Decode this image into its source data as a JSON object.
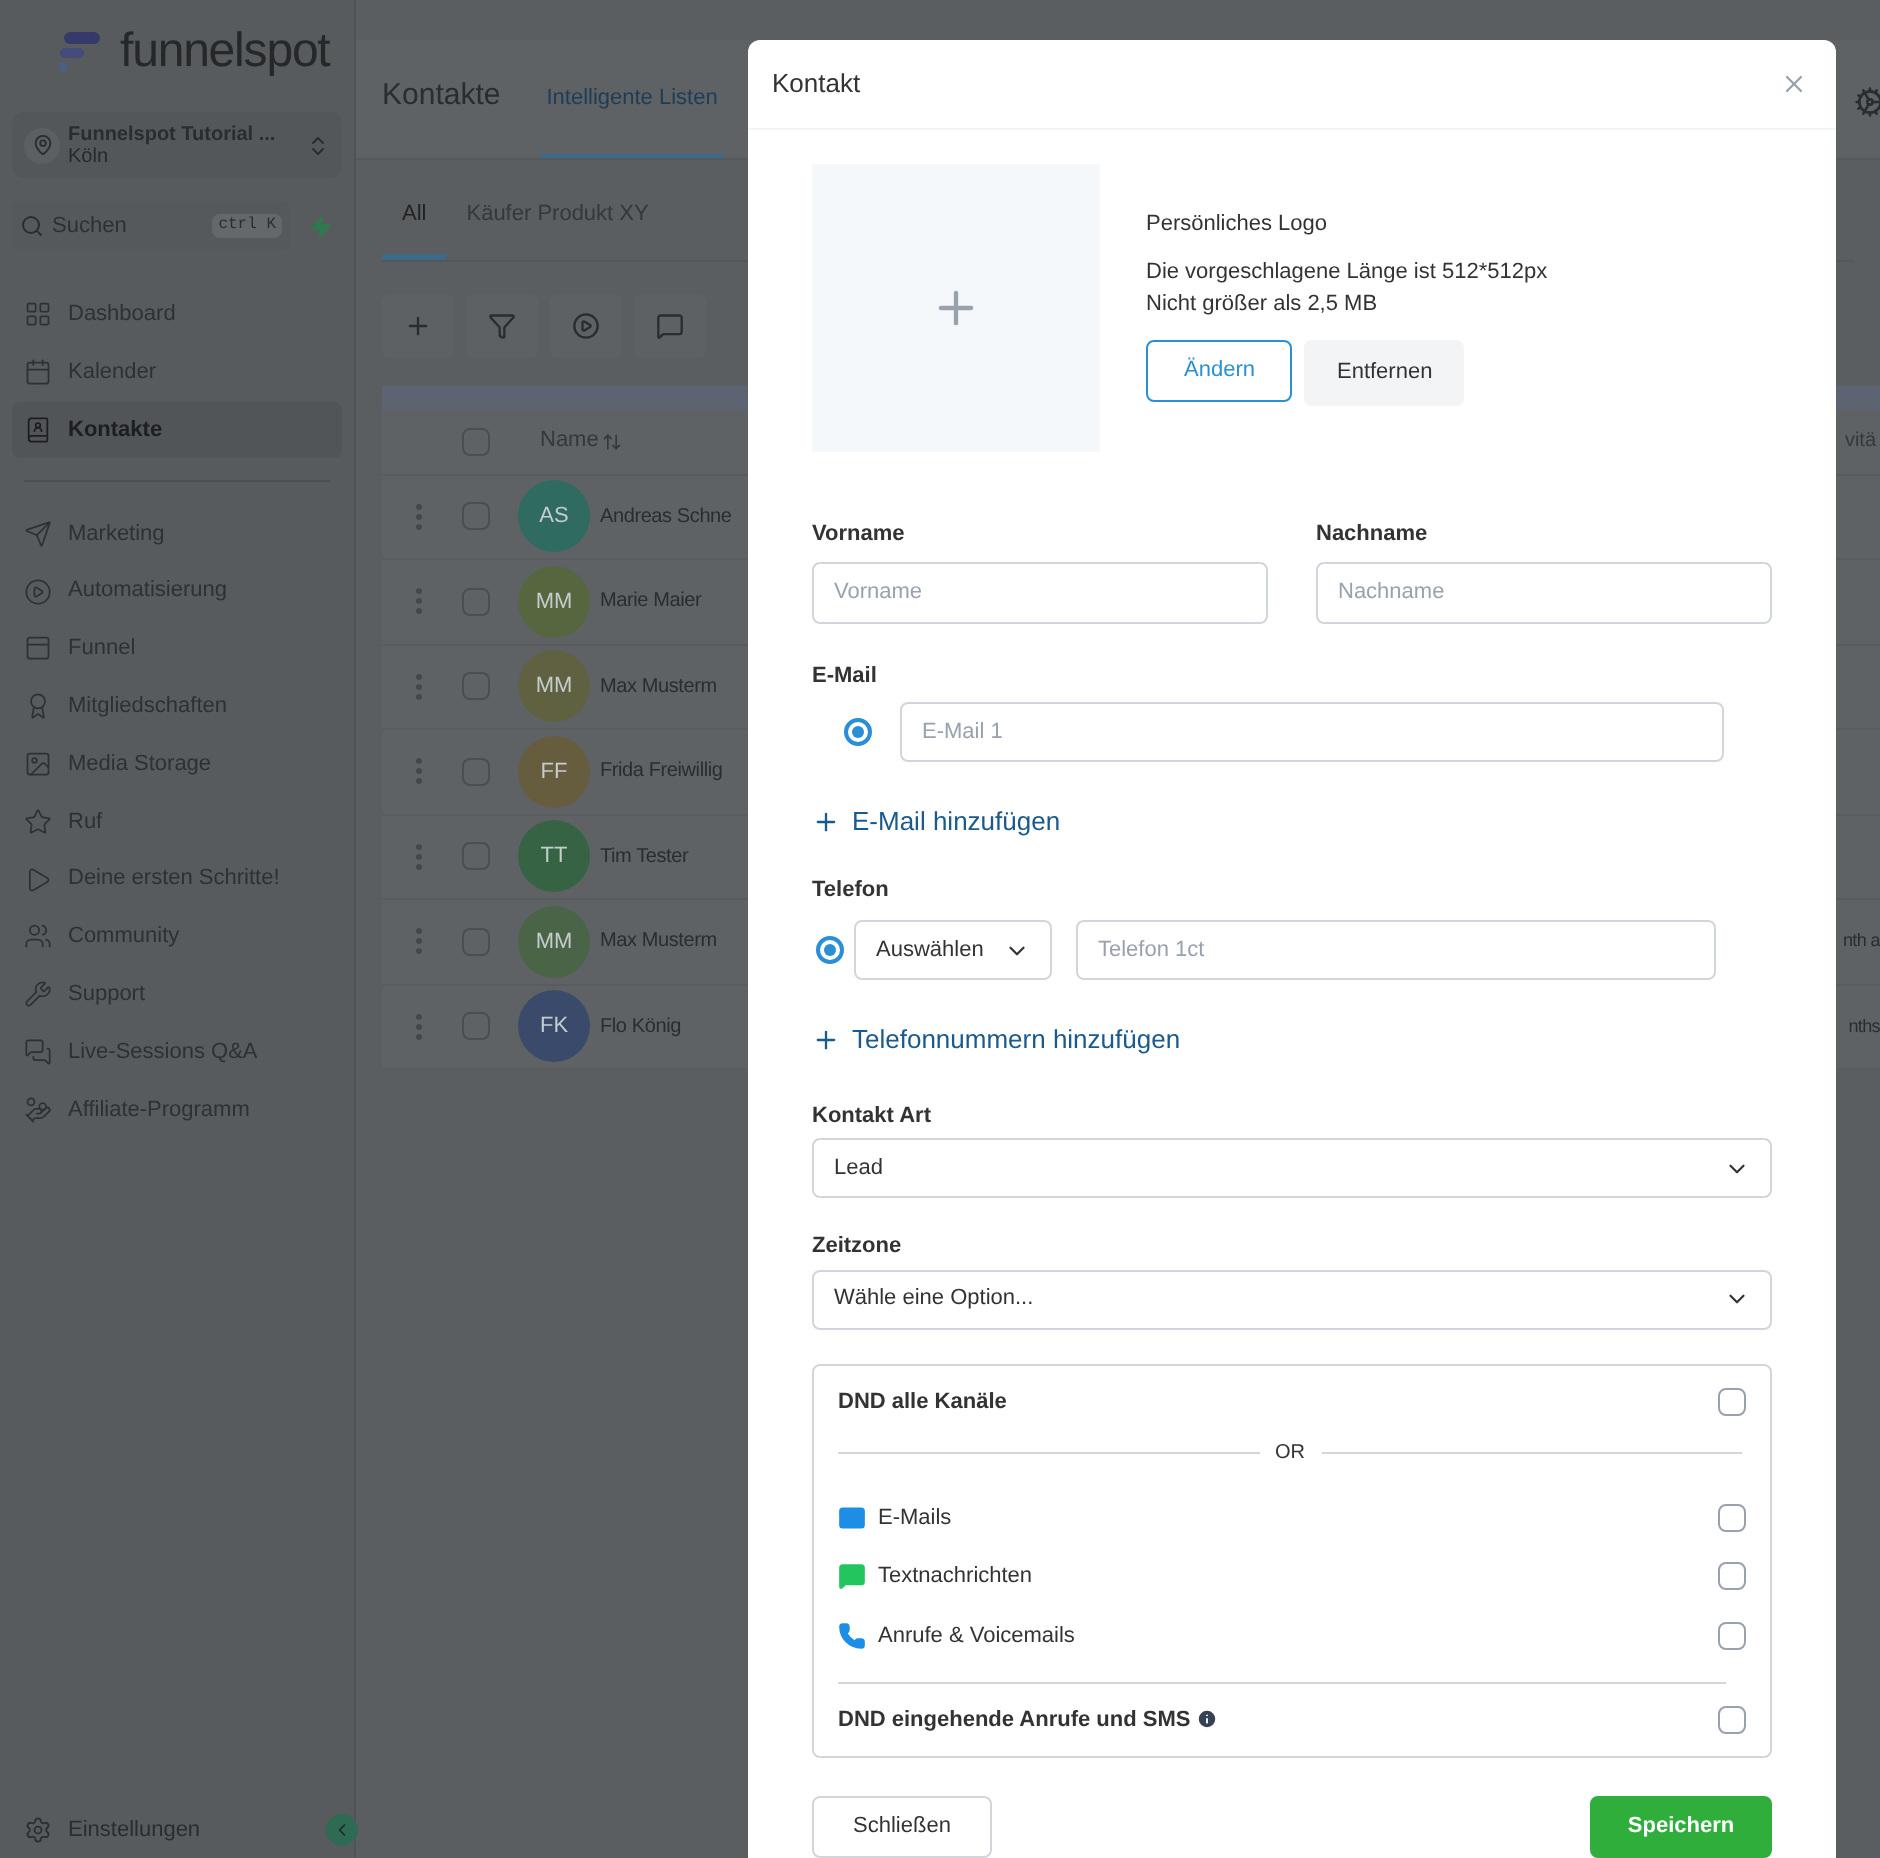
{
  "sidebar": {
    "logo": "funnelspot",
    "account": {
      "name": "Funnelspot Tutorial ...",
      "location": "Köln"
    },
    "search": {
      "placeholder": "Suchen",
      "shortcut": "ctrl K"
    },
    "sections": [
      {
        "items": [
          {
            "label": "Dashboard",
            "selected": false
          },
          {
            "label": "Kalender",
            "selected": false
          },
          {
            "label": "Kontakte",
            "selected": true
          }
        ]
      },
      {
        "items": [
          {
            "label": "Marketing",
            "selected": false
          },
          {
            "label": "Automatisierung",
            "selected": false
          },
          {
            "label": "Funnel",
            "selected": false
          },
          {
            "label": "Mitgliedschaften",
            "selected": false
          },
          {
            "label": "Media Storage",
            "selected": false
          },
          {
            "label": "Ruf",
            "selected": false
          },
          {
            "label": "Deine ersten Schritte!",
            "selected": false
          },
          {
            "label": "Community",
            "selected": false
          },
          {
            "label": "Support",
            "selected": false
          },
          {
            "label": "Live-Sessions Q&A",
            "selected": false
          },
          {
            "label": "Affiliate-Programm",
            "selected": false
          }
        ]
      }
    ],
    "settings": "Einstellungen"
  },
  "header": {
    "title": "Kontakte",
    "tabs": [
      {
        "label": "Intelligente Listen",
        "selected": true
      }
    ]
  },
  "list_tabs": [
    {
      "label": "All",
      "selected": true
    },
    {
      "label": "Käufer Produkt XY",
      "selected": false
    }
  ],
  "table": {
    "columns": [
      "Name",
      "vitä"
    ],
    "all_checked": false,
    "rows": [
      {
        "initials": "AS",
        "name": "Andreas Schne",
        "color": "#2f6b60",
        "checked": false
      },
      {
        "initials": "MM",
        "name": "Marie Maier",
        "color": "#56663f",
        "checked": false
      },
      {
        "initials": "MM",
        "name": "Max Musterm",
        "color": "#5f6140",
        "checked": false
      },
      {
        "initials": "FF",
        "name": "Frida Freiwillig",
        "color": "#665d3f",
        "checked": false
      },
      {
        "initials": "TT",
        "name": "Tim Tester",
        "color": "#366344",
        "checked": false
      },
      {
        "initials": "MM",
        "name": "Max Musterm",
        "color": "#4a6448",
        "checked": false,
        "column_2": "nth a"
      },
      {
        "initials": "FK",
        "name": "Flo König",
        "color": "#3a4a6a",
        "checked": false,
        "column_2": "nths"
      }
    ]
  },
  "dialog": {
    "title": "Kontakt",
    "logo": {
      "title": "Persönliches Logo",
      "hint_1": "Die vorgeschlagene Länge ist 512*512px",
      "hint_2": "Nicht größer als 2,5 MB",
      "change": "Ändern",
      "remove": "Entfernen"
    },
    "first_name": {
      "label": "Vorname",
      "placeholder": "Vorname"
    },
    "last_name": {
      "label": "Nachname",
      "placeholder": "Nachname"
    },
    "email": {
      "label": "E-Mail",
      "placeholder": "E-Mail 1",
      "selected": true,
      "add": "E-Mail hinzufügen"
    },
    "phone": {
      "label": "Telefon",
      "selected": true,
      "country": "Auswählen",
      "placeholder": "Telefon 1ct",
      "add": "Telefonnummern hinzufügen"
    },
    "contact_type": {
      "label": "Kontakt Art",
      "value": "Lead"
    },
    "timezone": {
      "label": "Zeitzone",
      "value": "Wähle eine Option..."
    },
    "dnd": {
      "all": {
        "label": "DND alle Kanäle",
        "checked": false
      },
      "separator": "OR",
      "channels": [
        {
          "label": "E-Mails",
          "checked": false
        },
        {
          "label": "Textnachrichten",
          "checked": false
        },
        {
          "label": "Anrufe & Voicemails",
          "checked": false
        }
      ],
      "inbound": {
        "label": "DND eingehende Anrufe und SMS",
        "checked": false
      }
    },
    "buttons": {
      "close": "Schließen",
      "save": "Speichern"
    }
  }
}
